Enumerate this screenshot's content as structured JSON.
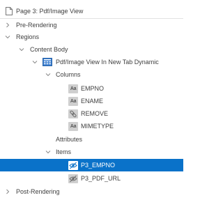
{
  "tree": {
    "page_label": "Page 3: Pdf/Image View",
    "pre_rendering": "Pre-Rendering",
    "regions": "Regions",
    "content_body": "Content Body",
    "region_name": "Pdf/Image View In New Tab Dynamic",
    "columns_label": "Columns",
    "columns": [
      "EMPNO",
      "ENAME",
      "REMOVE",
      "MIMETYPE"
    ],
    "attributes_label": "Attributes",
    "items_label": "Items",
    "items": [
      "P3_EMPNO",
      "P3_PDF_URL"
    ],
    "post_rendering": "Post-Rendering"
  },
  "colors": {
    "selection": "#0a72c9",
    "icon_bg": "#cfcfcf"
  },
  "icons": {
    "text_column": "AA",
    "link_column": "link-icon",
    "hidden_item": "hidden-item-icon"
  },
  "state": {
    "selected_item": "P3_EMPNO"
  }
}
